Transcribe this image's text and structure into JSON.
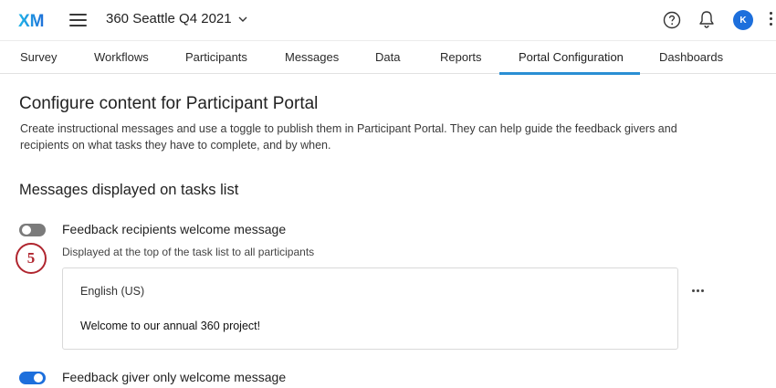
{
  "header": {
    "logo_text": "XM",
    "project_name": "360 Seattle Q4 2021",
    "avatar_initial": "K"
  },
  "tabs": [
    {
      "label": "Survey"
    },
    {
      "label": "Workflows"
    },
    {
      "label": "Participants"
    },
    {
      "label": "Messages"
    },
    {
      "label": "Data"
    },
    {
      "label": "Reports"
    },
    {
      "label": "Portal Configuration",
      "active": true
    },
    {
      "label": "Dashboards"
    }
  ],
  "content": {
    "title": "Configure content for Participant Portal",
    "description": "Create instructional messages and use a toggle to publish them in Participant Portal. They can help guide the feedback givers and recipients on what tasks they have to complete, and by when.",
    "section_title": "Messages displayed on tasks list",
    "step_number": "5",
    "messages": [
      {
        "title": "Feedback recipients welcome message",
        "subtitle": "Displayed at the top of the task list to all participants",
        "enabled": false,
        "language": "English (US)",
        "body": "Welcome to our annual 360 project!"
      },
      {
        "title": "Feedback giver only welcome message",
        "enabled": true
      }
    ]
  },
  "colors": {
    "accent": "#1d6fdc",
    "tab_underline": "#2a8fd4",
    "toggle_off": "#7b7b7b",
    "step_badge": "#b0262f"
  }
}
